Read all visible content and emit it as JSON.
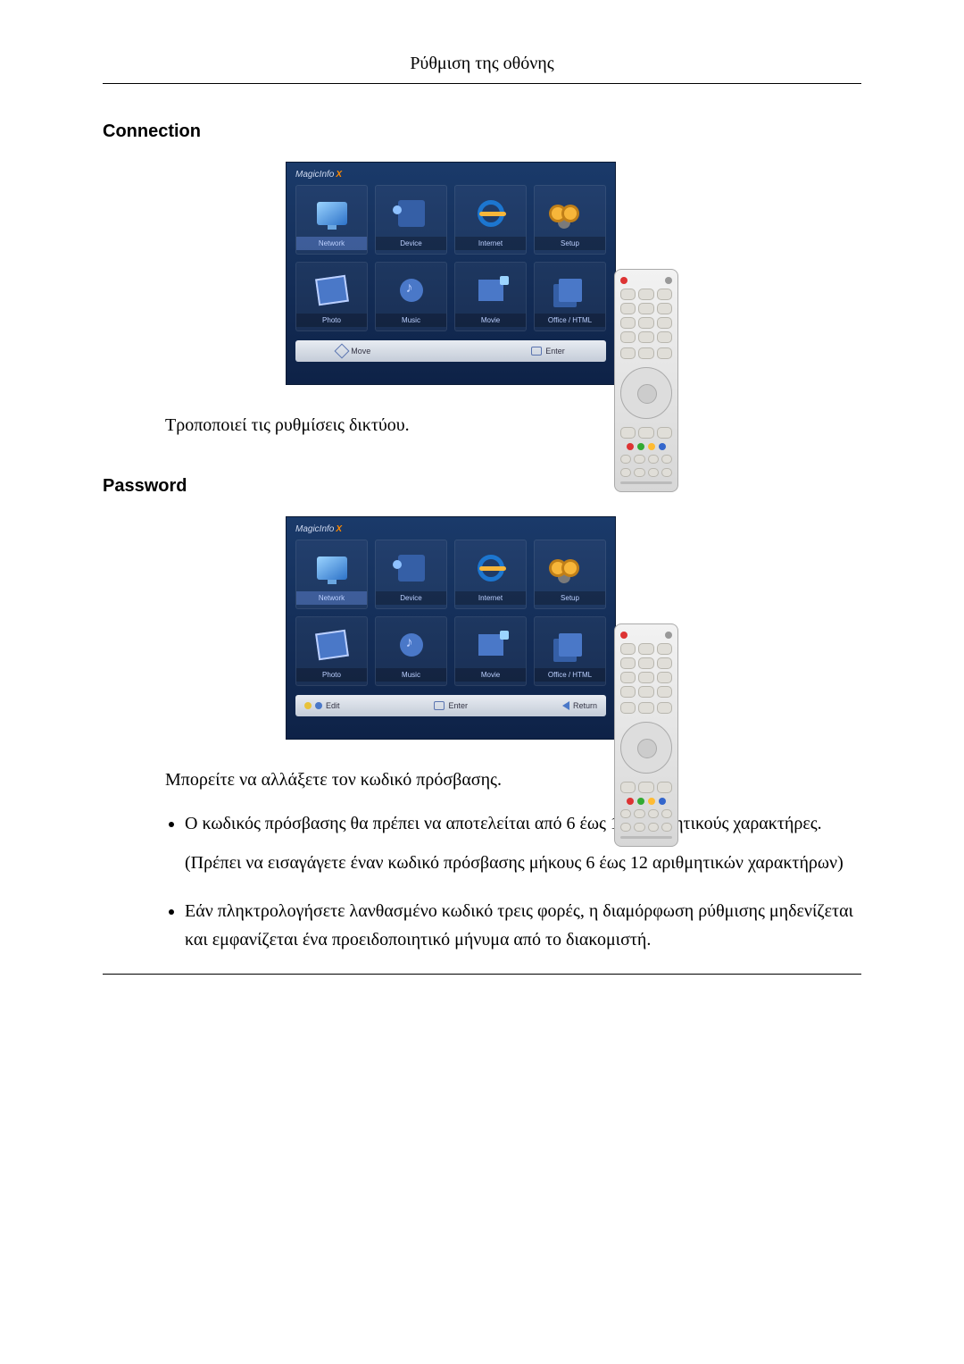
{
  "header": {
    "title": "Ρύθμιση της οθόνης"
  },
  "sections": {
    "connection": {
      "heading": "Connection",
      "description": "Τροποποιεί τις ρυθμίσεις δικτύου."
    },
    "password": {
      "heading": "Password",
      "intro": "Μπορείτε να αλλάξετε τον κωδικό πρόσβασης.",
      "bullets": {
        "b1": "Ο κωδικός πρόσβασης θα πρέπει να αποτελείται από 6 έως 12 αριθμητικούς χαρακτήρες.",
        "b1_sub": "(Πρέπει να εισαγάγετε έναν κωδικό πρόσβασης μήκους 6 έως 12 αριθμητικών χαρακτήρων)",
        "b2": "Εάν πληκτρολογήσετε λανθασμένο κωδικό τρεις φορές, η διαμόρφωση ρύθμισης μηδενίζεται και εμφανίζεται ένα προειδοποιητικό μήνυμα από το διακομιστή."
      }
    }
  },
  "ui": {
    "logo": "MagicInfo",
    "logo_x": "X",
    "tiles": {
      "network": "Network",
      "device": "Device",
      "internet": "Internet",
      "setup": "Setup",
      "photo": "Photo",
      "music": "Music",
      "movie": "Movie",
      "office": "Office / HTML"
    },
    "bar1": {
      "move": "Move",
      "enter": "Enter"
    },
    "bar2": {
      "edit": "Edit",
      "enter": "Enter",
      "ret": "Return"
    }
  }
}
